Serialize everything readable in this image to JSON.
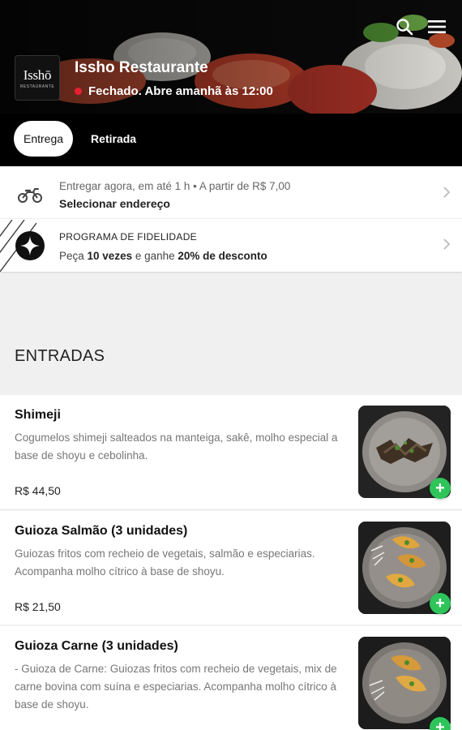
{
  "header": {
    "restaurant_name": "Issho Restaurante",
    "status": "Fechado. Abre amanhã às 12:00",
    "status_color": "#e8202f",
    "logo_text": "Isshō",
    "logo_subtext": "RESTAURANTE",
    "icons": [
      "search-icon",
      "menu-icon"
    ]
  },
  "tabs": [
    {
      "label": "Entrega",
      "active": true
    },
    {
      "label": "Retirada",
      "active": false
    }
  ],
  "delivery": {
    "icon": "motorcycle-icon",
    "info": "Entregar agora, em até 1 h • A partir de R$ 7,00",
    "action": "Selecionar endereço"
  },
  "loyalty": {
    "icon": "sparkle-star-icon",
    "title": "PROGRAMA DE FIDELIDADE",
    "prefix": "Peça ",
    "count": "10 vezes",
    "middle": " e ganhe ",
    "reward": "20% de desconto"
  },
  "section": {
    "title": "ENTRADAS"
  },
  "products": [
    {
      "name": "Shimeji",
      "description": "Cogumelos shimeji salteados na manteiga, sakê, molho especial a base de shoyu e cebolinha.",
      "price": "R$ 44,50"
    },
    {
      "name": "Guioza Salmão (3 unidades)",
      "description": "Guiozas fritos com recheio de vegetais, salmão e especiarias. Acompanha molho cítrico à base de shoyu.",
      "price": "R$ 21,50"
    },
    {
      "name": "Guioza Carne (3 unidades)",
      "description": "- Guioza de Carne: Guiozas fritos com recheio de vegetais, mix de carne bovina com suína e especiarias. Acompanha molho cítrico à base de shoyu.",
      "price": ""
    }
  ],
  "add_label": "+",
  "accent_color": "#2ec45a"
}
